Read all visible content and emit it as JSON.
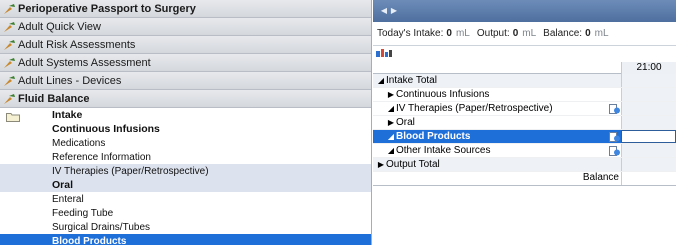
{
  "left_panel": {
    "bands": [
      {
        "label": "Perioperative Passport to Surgery"
      },
      {
        "label": "Adult Quick View"
      },
      {
        "label": "Adult Risk Assessments"
      },
      {
        "label": "Adult Systems Assessment"
      },
      {
        "label": "Adult Lines - Devices"
      },
      {
        "label": "Fluid Balance"
      }
    ],
    "fluid_balance_items": [
      {
        "label": "Intake",
        "style": "header"
      },
      {
        "label": "Continuous Infusions",
        "style": "header"
      },
      {
        "label": "Medications",
        "style": "normal"
      },
      {
        "label": "Reference Information",
        "style": "normal"
      },
      {
        "label": "IV Therapies (Paper/Retrospective)",
        "style": "alt"
      },
      {
        "label": "Oral",
        "style": "header-alt"
      },
      {
        "label": "Enteral",
        "style": "normal"
      },
      {
        "label": "Feeding Tube",
        "style": "normal"
      },
      {
        "label": "Surgical Drains/Tubes",
        "style": "normal"
      },
      {
        "label": "Blood Products",
        "style": "selected"
      }
    ]
  },
  "right_panel": {
    "totals": {
      "intake_label": "Today's Intake:",
      "intake_value": "0",
      "output_label": "Output:",
      "output_value": "0",
      "balance_label": "Balance:",
      "balance_value": "0",
      "unit": "mL"
    },
    "time_column": "21:00",
    "rows": [
      {
        "label": "Intake Total",
        "indent": 0,
        "expander": "◢"
      },
      {
        "label": "Continuous Infusions",
        "indent": 1,
        "expander": "▶"
      },
      {
        "label": "IV Therapies (Paper/Retrospective)",
        "indent": 1,
        "expander": "◢"
      },
      {
        "label": "Oral",
        "indent": 1,
        "expander": "▶"
      },
      {
        "label": "Blood Products",
        "indent": 1,
        "expander": "◢"
      },
      {
        "label": "Other Intake Sources",
        "indent": 1,
        "expander": "◢"
      },
      {
        "label": "Output Total",
        "indent": 0,
        "expander": "▶"
      }
    ],
    "balance_label": "Balance"
  },
  "colors": {
    "selection": "#1f6fd8",
    "band": "#d4d8dd",
    "tab_bar": "#5a7aa8"
  }
}
